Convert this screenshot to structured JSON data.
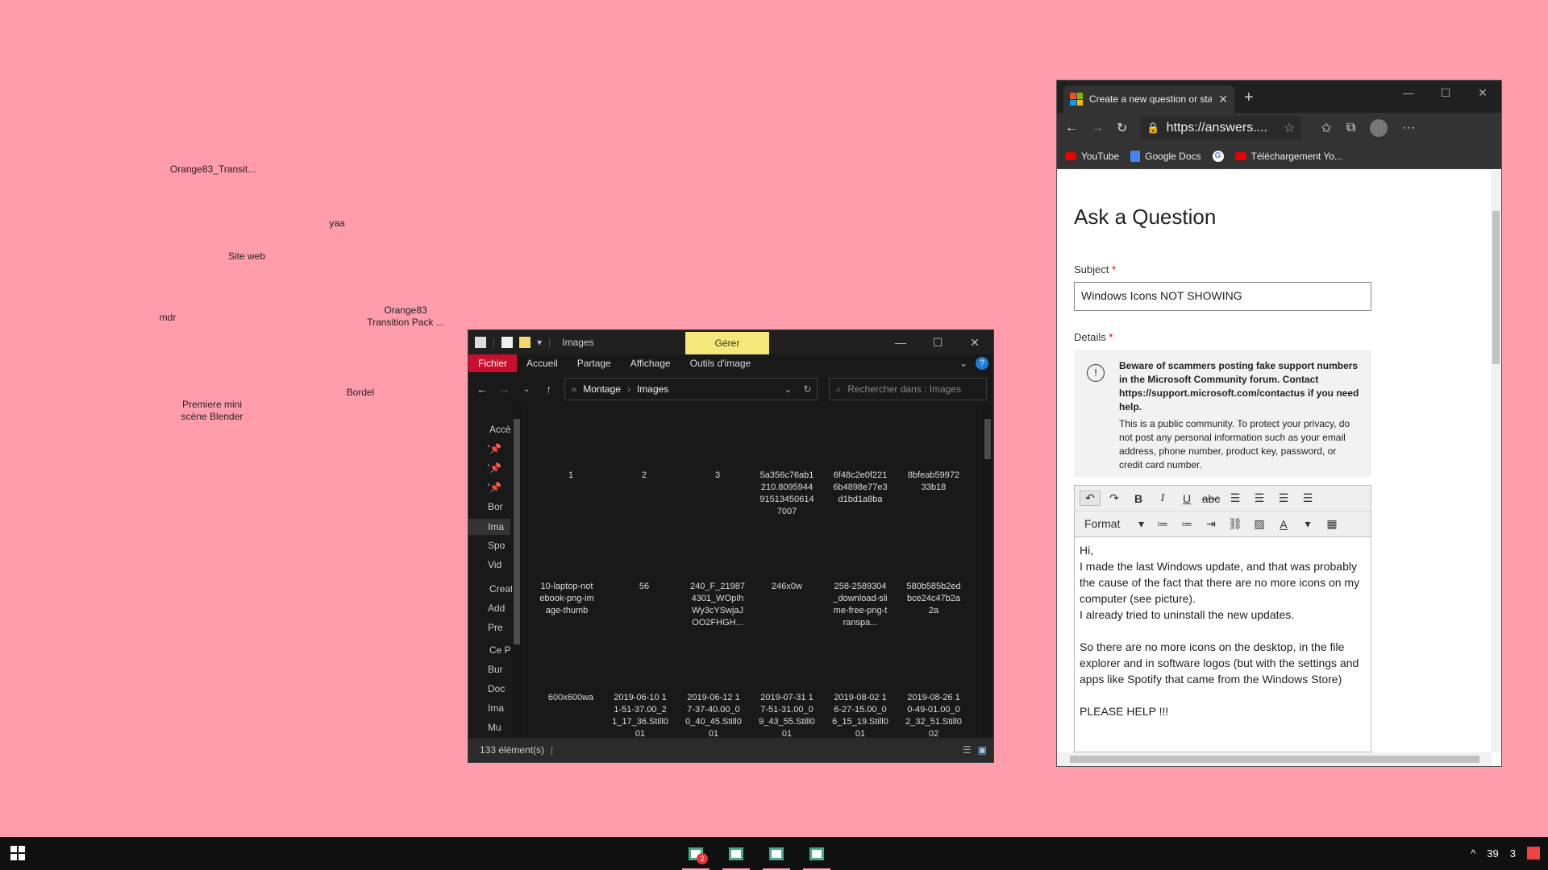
{
  "desktop": {
    "labels": [
      "Orange83_Transit...",
      "yaa",
      "Site web",
      "mdr",
      "Orange83\nTransition Pack ...",
      "Bordel",
      "Premiere mini\nscène Blender"
    ]
  },
  "explorer": {
    "title": "Images",
    "context_tab": "Gérer",
    "ribbon_tabs": [
      "Fichier",
      "Accueil",
      "Partage",
      "Affichage",
      "Outils d'image"
    ],
    "breadcrumb": [
      "Montage",
      "Images"
    ],
    "search_placeholder": "Rechercher dans : Images",
    "sidebar": [
      "Accè",
      "",
      "",
      "",
      "Bor",
      "Ima",
      "Spo",
      "Vid",
      "Creat",
      "Add",
      "Pre",
      "Ce P",
      "Bur",
      "Doc",
      "Ima",
      "Mu"
    ],
    "files": [
      "1",
      "2",
      "3",
      "5a356c76ab1210.809594491513450614 7007",
      "6f48c2e0f2216b4898e77e3d1bd1a8ba",
      "8bfeab5997233b18",
      "10-laptop-notebook-png-image-thumb",
      "56",
      "240_F_219874301_WOpIhWy3cYSwjaJOO2FHGH...",
      "246x0w",
      "258-2589304_download-slime-free-png-transpa...",
      "580b585b2edbce24c47b2a2a",
      "600x600wa",
      "2019-06-10 11-51-37.00_21_17_36.Still001",
      "2019-06-12 17-37-40.00_00_40_45.Still001",
      "2019-07-31 17-51-31.00_09_43_55.Still001",
      "2019-08-02 16-27-15.00_06_15_19.Still001",
      "2019-08-26 10-49-01.00_02_32_51.Still002"
    ],
    "status": "133 élément(s)"
  },
  "browser": {
    "tab_title": "Create a new question or start a",
    "url": "https://answers....",
    "bookmarks": [
      "YouTube",
      "Google Docs",
      "",
      "Téléchargement Yo..."
    ],
    "page": {
      "heading": "Ask a Question",
      "subject_label": "Subject",
      "subject_value": "Windows Icons NOT SHOWING",
      "details_label": "Details",
      "notice_bold": "Beware of scammers posting fake support numbers in the Microsoft Community forum. Contact https://support.microsoft.com/contactus if you need help.",
      "notice_text": "This is a public community. To protect your privacy, do not post any personal information such as your email address, phone number, product key, password, or credit card number.",
      "format_label": "Format",
      "body": "Hi,\nI made the last Windows update, and that was probably the cause of the fact that there are no more icons on my computer (see picture).\nI already tried to uninstall the new updates.\n\nSo there are no more icons on the desktop, in the file explorer and in software logos (but with the settings and apps like Spotify that came from the Windows Store)\n\nPLEASE HELP !!!"
    }
  },
  "taskbar": {
    "badge": "2",
    "tray_a": "39",
    "tray_b": "3"
  }
}
